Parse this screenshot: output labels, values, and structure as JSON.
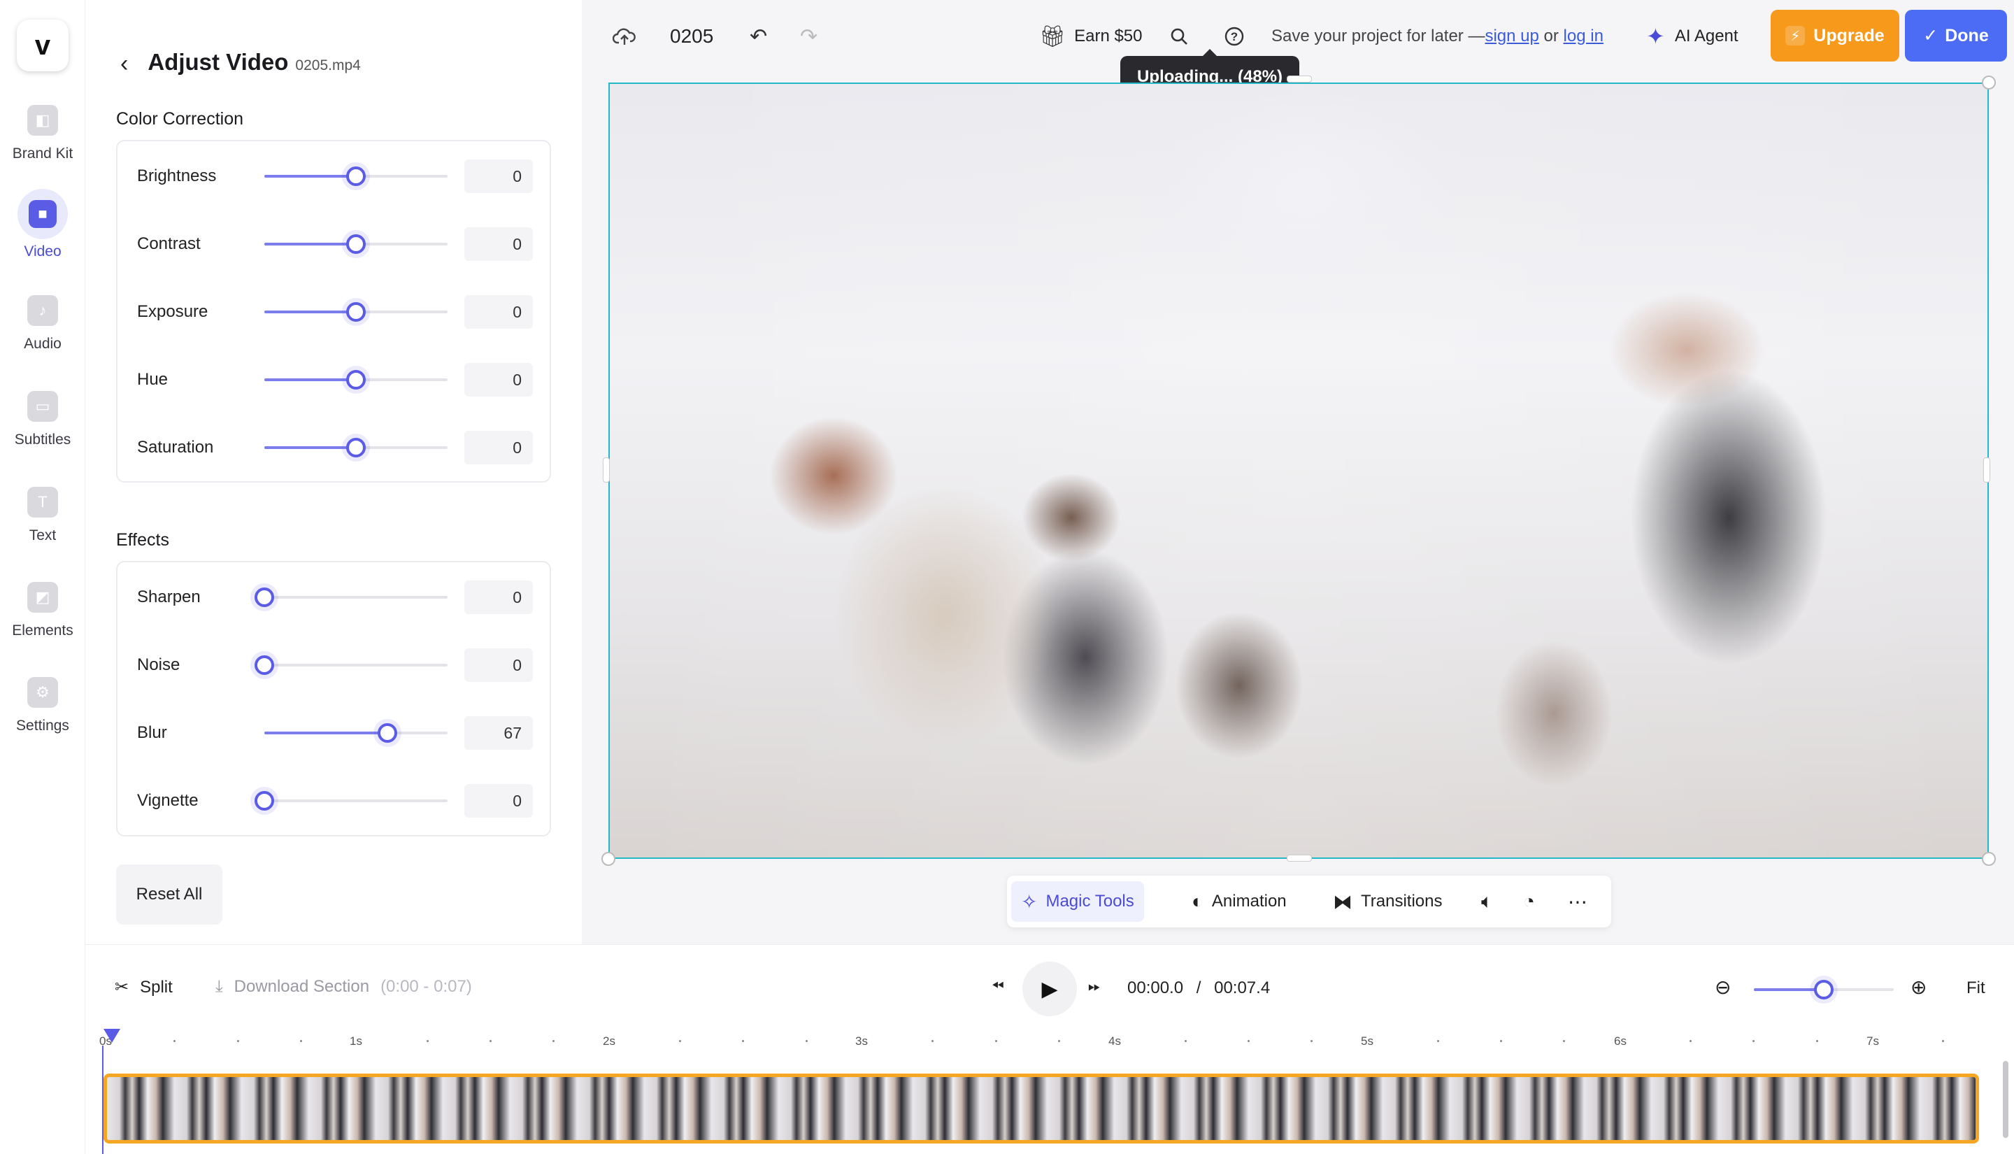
{
  "app": {
    "logo_letter": "v"
  },
  "rail": [
    {
      "label": "Brand Kit",
      "icon": "brand-kit-icon"
    },
    {
      "label": "Video",
      "icon": "video-icon"
    },
    {
      "label": "Audio",
      "icon": "music-note-icon"
    },
    {
      "label": "Subtitles",
      "icon": "subtitles-icon"
    },
    {
      "label": "Text",
      "icon": "text-icon"
    },
    {
      "label": "Elements",
      "icon": "elements-icon"
    },
    {
      "label": "Settings",
      "icon": "settings-icon"
    }
  ],
  "panel": {
    "title": "Adjust Video",
    "file": "0205.mp4",
    "color_title": "Color Correction",
    "effects_title": "Effects",
    "color": [
      {
        "label": "Brightness",
        "value": "0",
        "level": 0.5
      },
      {
        "label": "Contrast",
        "value": "0",
        "level": 0.5
      },
      {
        "label": "Exposure",
        "value": "0",
        "level": 0.5
      },
      {
        "label": "Hue",
        "value": "0",
        "level": 0.5
      },
      {
        "label": "Saturation",
        "value": "0",
        "level": 0.5
      }
    ],
    "effects": [
      {
        "label": "Sharpen",
        "value": "0",
        "level": 0
      },
      {
        "label": "Noise",
        "value": "0",
        "level": 0
      },
      {
        "label": "Blur",
        "value": "67",
        "level": 0.67
      },
      {
        "label": "Vignette",
        "value": "0",
        "level": 0
      }
    ],
    "reset_label": "Reset All"
  },
  "topbar": {
    "project_name": "0205",
    "earn_label": "Earn $50",
    "save_prefix": "Save your project for later — ",
    "sign_up": "sign up",
    "or": " or ",
    "log_in": "log in",
    "ai_agent": "AI Agent",
    "upgrade": "Upgrade",
    "done": "Done",
    "upload_tooltip": "Uploading... (48%)",
    "upload_progress": 0.48
  },
  "floatbar": {
    "magic_tools": "Magic Tools",
    "animation": "Animation",
    "transitions": "Transitions"
  },
  "timeline": {
    "split": "Split",
    "download_section": "Download Section",
    "download_range": "(0:00 - 0:07)",
    "current_time": "00:00.0",
    "separator": "/",
    "total_time": "00:07.4",
    "fit": "Fit",
    "zoom_level": 0.5,
    "ticks": [
      "0s",
      "1s",
      "2s",
      "3s",
      "4s",
      "5s",
      "6s",
      "7s"
    ]
  },
  "colors": {
    "accent": "#5b5ce6",
    "upgrade": "#f79a1b",
    "done": "#4d6cf6",
    "selection": "#22b8c8",
    "clip_border": "#f5a623"
  }
}
